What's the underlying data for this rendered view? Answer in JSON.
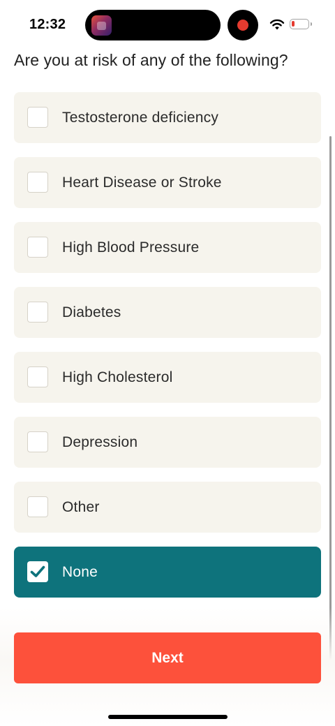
{
  "status_bar": {
    "time": "12:32",
    "recording_color": "#e53b2f",
    "battery_color": "#e53b2f",
    "icons": [
      "app-icon",
      "recording-icon",
      "wifi-icon",
      "battery-icon"
    ]
  },
  "question": "Are you at risk of any of the following?",
  "options": [
    {
      "label": "Testosterone deficiency",
      "checked": false
    },
    {
      "label": "Heart Disease or Stroke",
      "checked": false
    },
    {
      "label": "High Blood Pressure",
      "checked": false
    },
    {
      "label": "Diabetes",
      "checked": false
    },
    {
      "label": "High Cholesterol",
      "checked": false
    },
    {
      "label": "Depression",
      "checked": false
    },
    {
      "label": "Other",
      "checked": false
    },
    {
      "label": "None",
      "checked": true
    }
  ],
  "next_button": {
    "label": "Next"
  },
  "colors": {
    "option_bg": "#f6f4ed",
    "selected_bg": "#0e737c",
    "primary_button": "#fd513b"
  }
}
